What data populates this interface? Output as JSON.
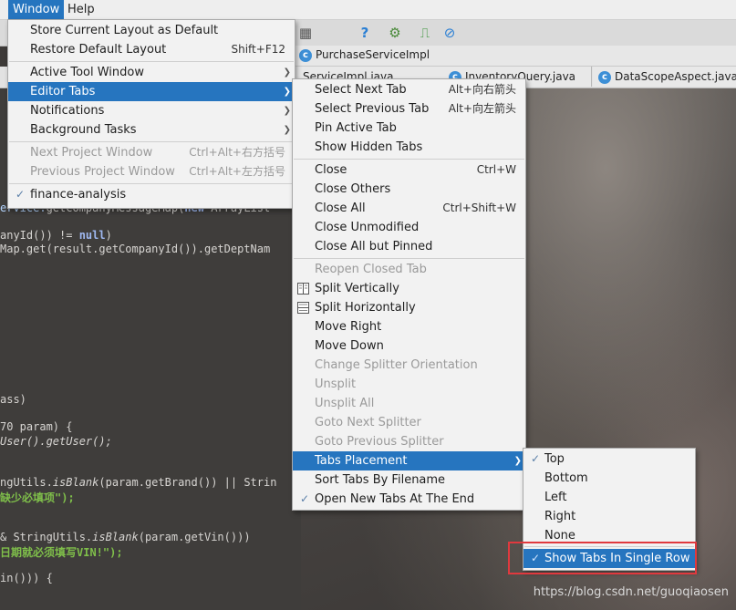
{
  "menubar": {
    "items": [
      {
        "label": "Window"
      },
      {
        "label": "Help"
      }
    ]
  },
  "tabs": {
    "breadcrumb": "PurchaseServiceImpl",
    "files": [
      {
        "label": "ServiceImpl.java"
      },
      {
        "label": "InventoryQuery.java"
      },
      {
        "label": "DataScopeAspect.java"
      }
    ]
  },
  "editor": {
    "lines": [
      {
        "plain": "ervice.",
        "call": "getCompanyMessageMap(",
        "kw": "new",
        "rest": " ArrayList"
      },
      {
        "plain": "anyId()) != ",
        "kw": "null",
        "rest": ")"
      },
      {
        "plain": "Map.get(result.getCompanyId()).getDeptNam"
      },
      {
        "plain": "ass)"
      },
      {
        "plain": "70 param) {"
      },
      {
        "plain": "User().getUser();"
      },
      {
        "plain": "ngUtils.",
        "it": "isBlank",
        "rest": "(param.getBrand()) || Strin"
      },
      {
        "str": "缺少必填项\");"
      },
      {
        "plain": "& StringUtils.",
        "it": "isBlank",
        "rest": "(param.getVin()))"
      },
      {
        "str": "日期就必须填写VIN!\");"
      },
      {
        "plain": "in())) {"
      }
    ]
  },
  "window_menu": {
    "items": [
      {
        "label": "Store Current Layout as Default",
        "shortcut": ""
      },
      {
        "label": "Restore Default Layout",
        "shortcut": "Shift+F12"
      },
      {
        "label": "Active Tool Window",
        "submenu": true
      },
      {
        "label": "Editor Tabs",
        "submenu": true,
        "selected": true
      },
      {
        "label": "Notifications",
        "submenu": true
      },
      {
        "label": "Background Tasks",
        "submenu": true
      },
      {
        "label": "Next Project Window",
        "shortcut": "Ctrl+Alt+右方括号",
        "disabled": true
      },
      {
        "label": "Previous Project Window",
        "shortcut": "Ctrl+Alt+左方括号",
        "disabled": true
      },
      {
        "label": "finance-analysis",
        "checked": true
      }
    ]
  },
  "editor_tabs_menu": {
    "items": [
      {
        "label": "Select Next Tab",
        "shortcut": "Alt+向右箭头"
      },
      {
        "label": "Select Previous Tab",
        "shortcut": "Alt+向左箭头"
      },
      {
        "label": "Pin Active Tab"
      },
      {
        "label": "Show Hidden Tabs"
      },
      {
        "label": "Close",
        "shortcut": "Ctrl+W"
      },
      {
        "label": "Close Others"
      },
      {
        "label": "Close All",
        "shortcut": "Ctrl+Shift+W"
      },
      {
        "label": "Close Unmodified"
      },
      {
        "label": "Close All but Pinned"
      },
      {
        "label": "Reopen Closed Tab",
        "disabled": true
      },
      {
        "label": "Split Vertically",
        "icon": "split-vertical-icon"
      },
      {
        "label": "Split Horizontally",
        "icon": "split-horizontal-icon"
      },
      {
        "label": "Move Right"
      },
      {
        "label": "Move Down"
      },
      {
        "label": "Change Splitter Orientation",
        "disabled": true
      },
      {
        "label": "Unsplit",
        "disabled": true
      },
      {
        "label": "Unsplit All",
        "disabled": true
      },
      {
        "label": "Goto Next Splitter",
        "disabled": true
      },
      {
        "label": "Goto Previous Splitter",
        "disabled": true
      },
      {
        "label": "Tabs Placement",
        "submenu": true,
        "selected": true
      },
      {
        "label": "Sort Tabs By Filename"
      },
      {
        "label": "Open New Tabs At The End",
        "checked": true
      }
    ]
  },
  "placement_menu": {
    "items": [
      {
        "label": "Top",
        "checked": true
      },
      {
        "label": "Bottom"
      },
      {
        "label": "Left"
      },
      {
        "label": "Right"
      },
      {
        "label": "None"
      },
      {
        "label": "Show Tabs In Single Row",
        "checked": true,
        "selected": true
      }
    ]
  },
  "watermark": "https://blog.csdn.net/guoqiaosen",
  "colors": {
    "selection": "#2675bf",
    "highlight_box": "#e0393e"
  }
}
